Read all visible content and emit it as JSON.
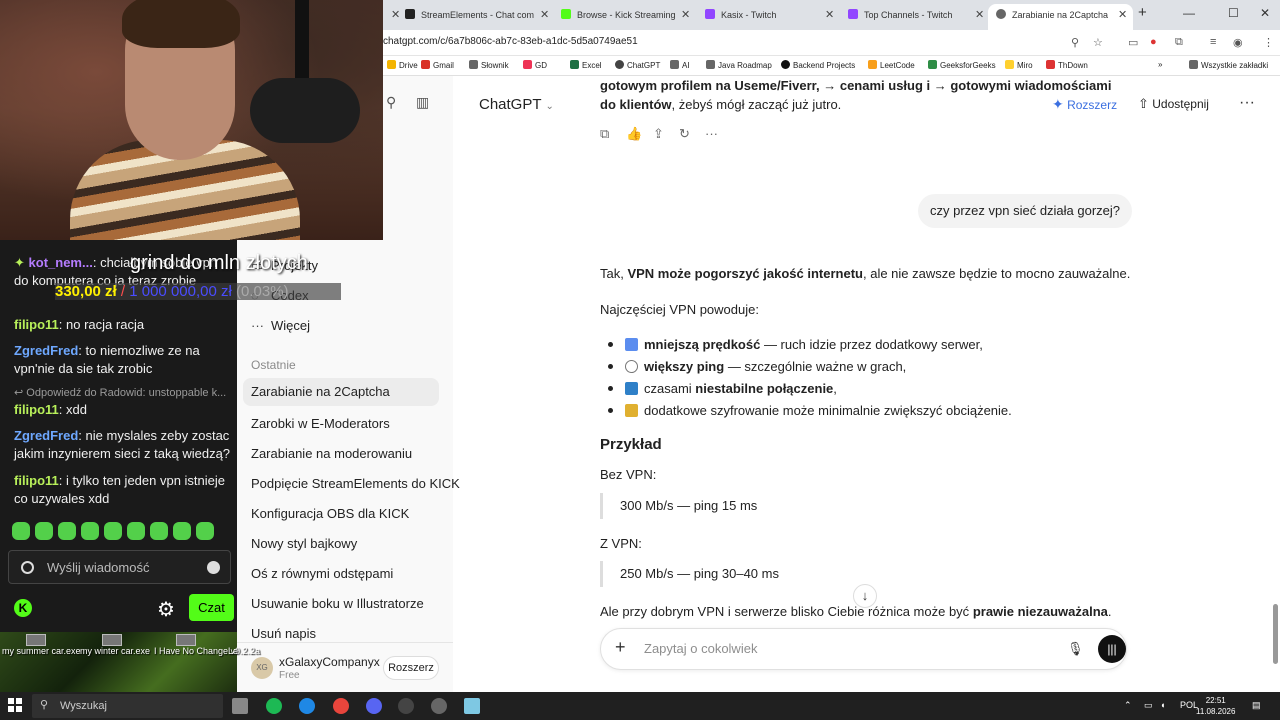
{
  "browser": {
    "tabs": [
      {
        "label": "StreamElements - Chat com",
        "color": "#222222"
      },
      {
        "label": "Browse - Kick Streaming",
        "color": "#53fc18"
      },
      {
        "label": "Kasix - Twitch",
        "color": "#9146ff"
      },
      {
        "label": "Top Channels - Twitch",
        "color": "#9146ff"
      },
      {
        "label": "Zarabianie na 2Captcha",
        "color": "#666666"
      }
    ],
    "url": "chatgpt.com/c/6a7b806c-ab7c-83eb-a1dc-5d5a0749ae51",
    "bookmarks": [
      "Drive",
      "Gmail",
      "Słownik",
      "GD",
      "Excel",
      "ChatGPT",
      "AI",
      "Java Roadmap",
      "Backend Projects",
      "LeetCode",
      "GeeksforGeeks",
      "Miro",
      "ThDown"
    ],
    "all_bookmarks": "Wszystkie zakładki"
  },
  "chatgpt": {
    "model": "ChatGPT",
    "upgrade_label": "Rozszerz",
    "share_label": "Udostępnij",
    "prev_line1": "gotowym profilem na Useme/Fiverr, → cenami usług i → gotowymi wiadomościami",
    "prev_line2_bold": "do klientów",
    "prev_line2_rest": ", żebyś mógł zacząć już jutro.",
    "user_message": "czy przez vpn sieć działa gorzej?",
    "answer_intro_a": "Tak, ",
    "answer_intro_bold": "VPN może pogorszyć jakość internetu",
    "answer_intro_b": ", ale nie zawsze będzie to mocno zauważalne.",
    "causes_intro": "Najczęściej VPN powoduje:",
    "bullets": [
      {
        "bold": "mniejszą prędkość",
        "rest": " — ruch idzie przez dodatkowy serwer,",
        "pre": "",
        "color": "#5b8def"
      },
      {
        "bold": "większy ping",
        "rest": " — szczególnie ważne w grach,",
        "pre": "",
        "color": "#777777"
      },
      {
        "bold": "niestabilne połączenie",
        "rest": ",",
        "pre": "czasami ",
        "color": "#2f80c8"
      },
      {
        "bold": "",
        "rest": "dodatkowe szyfrowanie może minimalnie zwiększyć obciążenie.",
        "pre": "",
        "color": "#e0b030"
      }
    ],
    "example_heading": "Przykład",
    "without_vpn": "Bez VPN:",
    "without_vpn_value": "300 Mb/s — ping 15 ms",
    "with_vpn": "Z VPN:",
    "with_vpn_value": "250 Mb/s — ping 30–40 ms",
    "conclusion_a": "Ale przy dobrym VPN i serwerze blisko Ciebie różnica może być ",
    "conclusion_bold": "prawie niezauważalna",
    "conclusion_b": ".",
    "composer_placeholder": "Zapytaj o cokolwiek"
  },
  "sidebar": {
    "nav": [
      {
        "label": "Projekty",
        "icon": "folder-icon"
      },
      {
        "label": "Codex",
        "icon": "codex-icon"
      },
      {
        "label": "Więcej",
        "icon": "more-icon"
      }
    ],
    "recent_heading": "Ostatnie",
    "recent": [
      "Zarabianie na 2Captcha",
      "Zarobki w E-Moderators",
      "Zarabianie na moderowaniu",
      "Podpięcie StreamElements do KICK",
      "Konfiguracja OBS dla KICK",
      "Nowy styl bajkowy",
      "Oś z równymi odstępami",
      "Usuwanie boku w Illustratorze",
      "Usuń napis"
    ],
    "account_name": "xGalaxyCompanyx",
    "account_plan": "Free",
    "account_initials": "XG",
    "account_upgrade": "Rozszerz"
  },
  "overlay": {
    "goal_title": "grind do mln złotych",
    "goal_current": "330,00 zł",
    "goal_separator": "/",
    "goal_target": "1 000 000,00 zł",
    "goal_percent": "(0.03%)"
  },
  "chat": {
    "messages": [
      {
        "user": "kot_nem...",
        "text": "chciałbym sobie vpn do komputera co ja teraz zrobie",
        "color": "green"
      },
      {
        "user": "filipo11",
        "text": "no racja racja",
        "color": "green"
      },
      {
        "user": "ZgredFred",
        "text": "to niemozliwe ze na vpn'nie da sie tak zrobic",
        "color": "blue"
      },
      {
        "user": "filipo11",
        "text": "xdd",
        "color": "green"
      },
      {
        "user": "ZgredFred",
        "text": "nie myslales zeby zostac jakim inzynierem sieci z taką wiedzą?",
        "color": "blue"
      },
      {
        "user": "filipo11",
        "text": "i tylko ten jeden vpn istnieje co uzywales xdd",
        "color": "green"
      }
    ],
    "reply_label": "Odpowiedź do Radowid: unstoppable k...",
    "input_placeholder": "Wyślij wiadomość",
    "send_label": "Czat",
    "kick_letter": "K"
  },
  "desktop_icons": [
    "my summer car.exe",
    "my winter car.exe",
    "I Have No Change v0.2.2a",
    "Le"
  ],
  "taskbar": {
    "search_placeholder": "Wyszukaj",
    "language": "POL",
    "time": "22:51",
    "date": "11.08.2026"
  }
}
